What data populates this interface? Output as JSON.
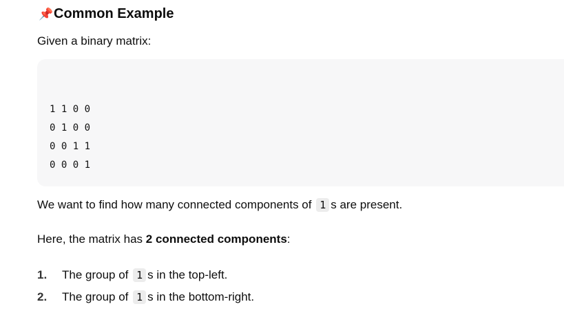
{
  "heading": {
    "emoji": "📌",
    "text": "Common Example"
  },
  "intro": "Given a binary matrix:",
  "matrix_rows": [
    "1 1 0 0",
    "0 1 0 0",
    "0 0 1 1",
    "0 0 0 1"
  ],
  "para1": {
    "before": "We want to find how many connected components of",
    "code": "1",
    "after": "s are present."
  },
  "para2": {
    "before": "Here, the matrix has",
    "bold": "2 connected components",
    "after": ":"
  },
  "list": [
    {
      "num": "1.",
      "before": "The group of",
      "code": "1",
      "after": "s in the top-left."
    },
    {
      "num": "2.",
      "before": "The group of",
      "code": "1",
      "after": "s in the bottom-right."
    }
  ]
}
